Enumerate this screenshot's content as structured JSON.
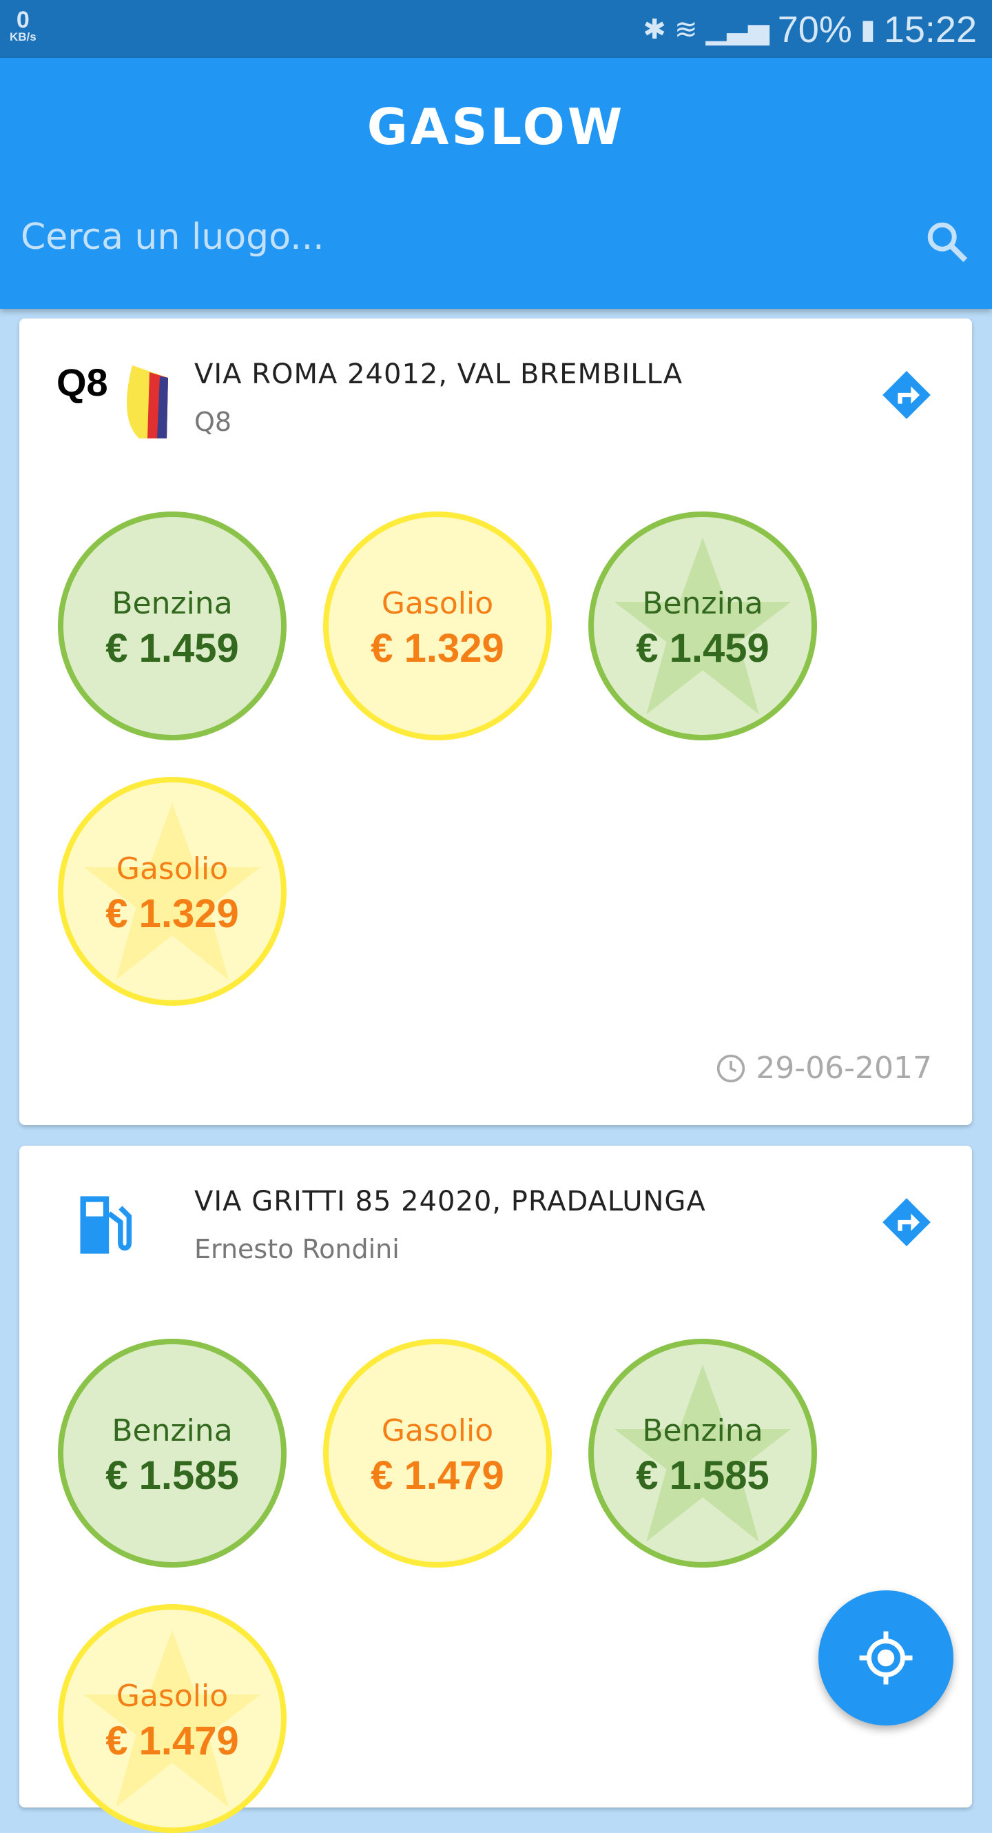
{
  "status_bar": {
    "speed_value": "0",
    "speed_unit": "KB/s",
    "battery": "70%",
    "time": "15:22"
  },
  "app": {
    "title": "GASLOW"
  },
  "search": {
    "placeholder": "Cerca un luogo..."
  },
  "colors": {
    "primary": "#2196F3",
    "benzina": "#8BC34A",
    "gasolio": "#FFEB3B"
  },
  "stations": [
    {
      "address": "VIA ROMA  24012, VAL BREMBILLA",
      "brand": "Q8",
      "logo": "Q8",
      "date": "29-06-2017",
      "prices": [
        {
          "fuel": "Benzina",
          "price": "€ 1.459",
          "starred": false
        },
        {
          "fuel": "Gasolio",
          "price": "€ 1.329",
          "starred": false
        },
        {
          "fuel": "Benzina",
          "price": "€ 1.459",
          "starred": true
        },
        {
          "fuel": "Gasolio",
          "price": "€ 1.329",
          "starred": true
        }
      ]
    },
    {
      "address": "VIA GRITTI 85 24020, PRADALUNGA",
      "brand": "Ernesto Rondini",
      "logo": "fuel-pump-icon",
      "prices": [
        {
          "fuel": "Benzina",
          "price": "€ 1.585",
          "starred": false
        },
        {
          "fuel": "Gasolio",
          "price": "€ 1.479",
          "starred": false
        },
        {
          "fuel": "Benzina",
          "price": "€ 1.585",
          "starred": true
        },
        {
          "fuel": "Gasolio",
          "price": "€ 1.479",
          "starred": true
        }
      ]
    }
  ]
}
